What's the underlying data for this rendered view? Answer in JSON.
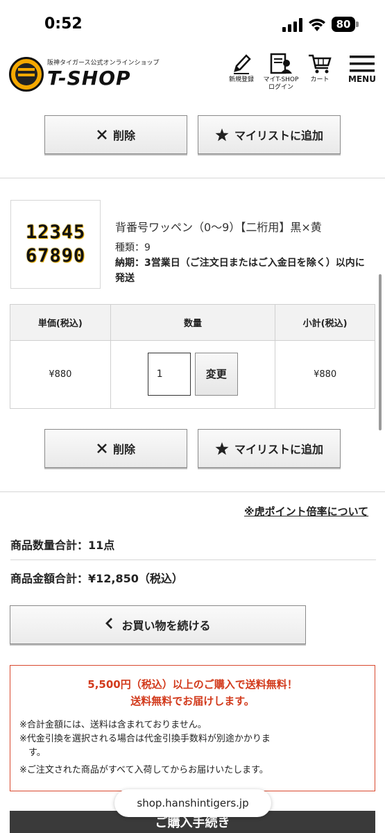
{
  "status": {
    "time": "0:52",
    "battery": "80"
  },
  "header": {
    "logo_sub": "阪神タイガース公式オンラインショップ",
    "logo_main": "T-SHOP",
    "register_label": "新規登録",
    "mypage_label_1": "マイT-SHOP",
    "mypage_label_2": "ログイン",
    "cart_label": "カート",
    "menu_label": "MENU"
  },
  "item_actions": {
    "delete_label": "削除",
    "mylist_label": "マイリストに追加"
  },
  "product": {
    "thumb_line1": "12345",
    "thumb_line2": "67890",
    "name": "背番号ワッペン（0〜9）【二桁用】黒×黄",
    "kind": "種類：9",
    "delivery": "納期：3営業日（ご注文日またはご入金日を除く）以内に発送"
  },
  "table": {
    "headers": [
      "単価(税込)",
      "数量",
      "小計(税込)"
    ],
    "unit_price": "¥880",
    "quantity": "1",
    "change_label": "変更",
    "subtotal": "¥880"
  },
  "totals": {
    "tora_link": "※虎ポイント倍率について",
    "count": "商品数量合計：11点",
    "amount": "商品金額合計：¥12,850（税込）"
  },
  "continue_label": "お買い物を続ける",
  "notice": {
    "title1": "5,500円（税込）以上のご購入で送料無料！",
    "title2": "送料無料でお届けします。",
    "note1": "※合計金額には、送料は含まれておりません。",
    "note2a": "※代金引換を選択される場合は代金引換手数料が別途かかりま",
    "note2b": "す。",
    "note3": "※ご注文された商品がすべて入荷してからお届けいたします。"
  },
  "purchase_label": "ご購入手続き",
  "url": "shop.hanshintigers.jp"
}
